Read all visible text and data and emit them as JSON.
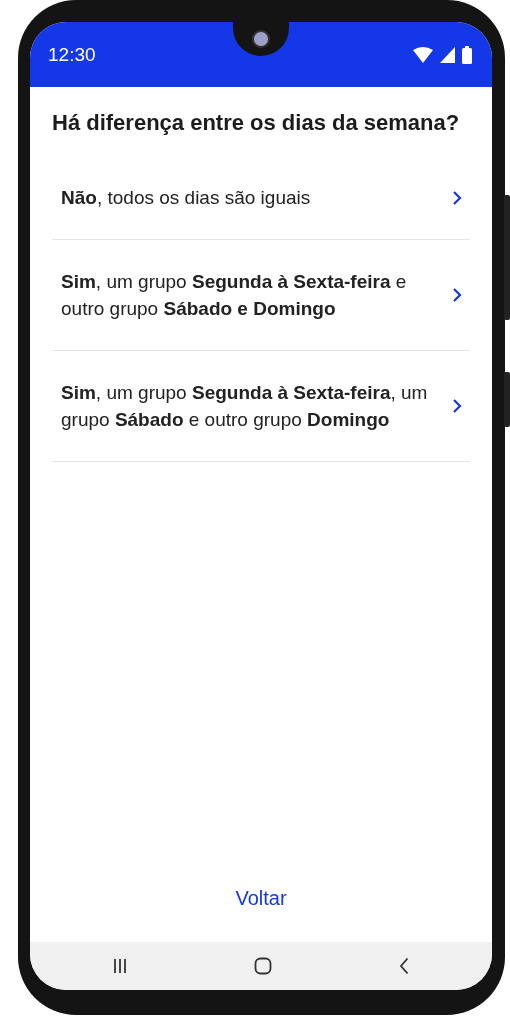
{
  "status_bar": {
    "time": "12:30"
  },
  "title": "Há diferença entre os dias da semana?",
  "options": [
    {
      "text": "**Não**, todos os dias são iguais"
    },
    {
      "text": "**Sim**, um grupo **Segunda à Sexta-feira** e outro grupo **Sábado e Domingo**"
    },
    {
      "text": "**Sim**, um grupo **Segunda à Sexta-feira**, um grupo **Sábado** e outro grupo **Domingo**"
    }
  ],
  "back_link": "Voltar"
}
